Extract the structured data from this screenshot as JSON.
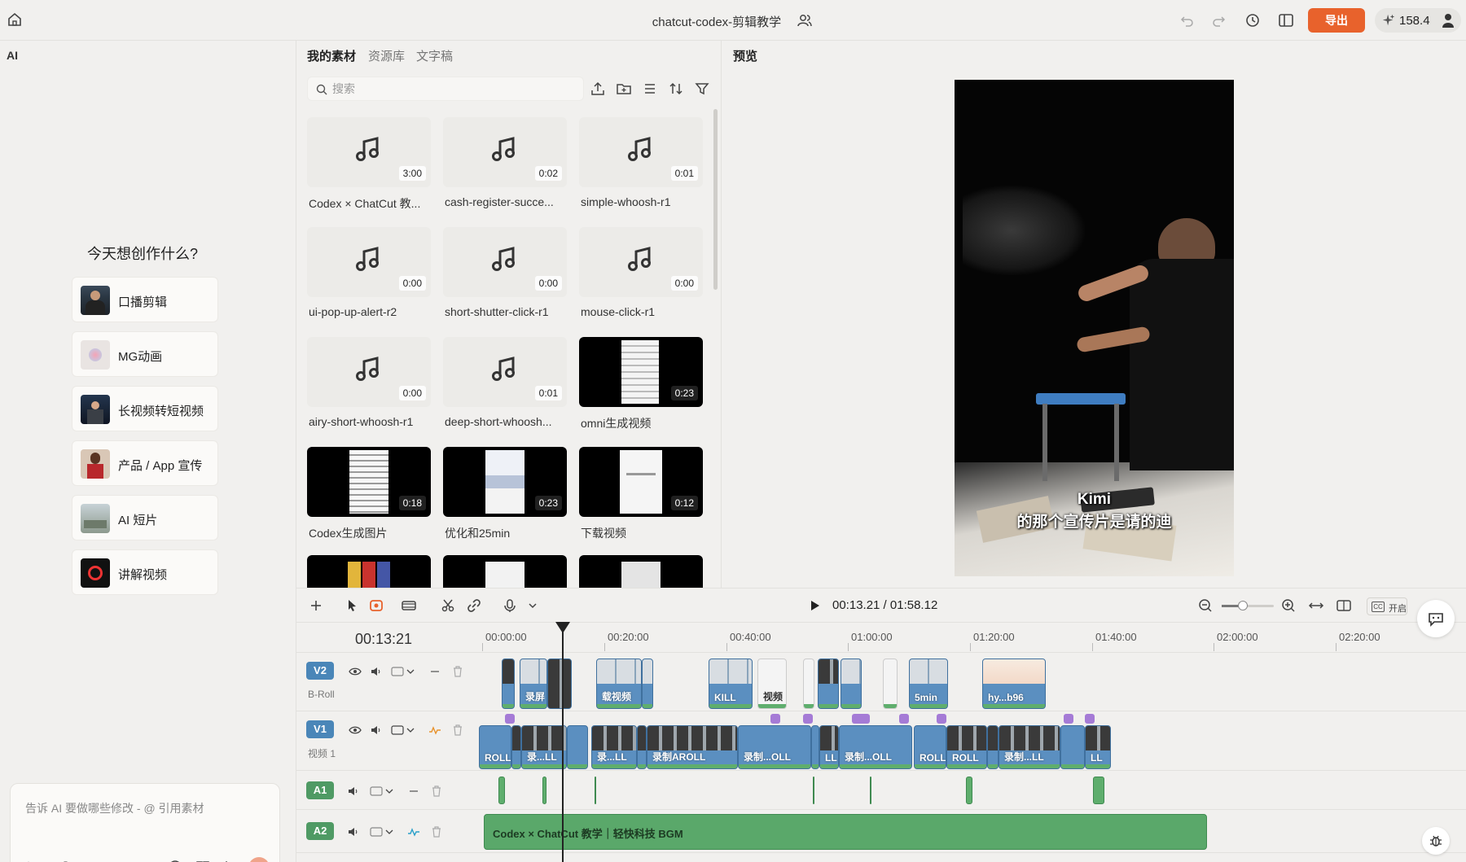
{
  "topbar": {
    "title": "chatcut-codex-剪辑教学",
    "export_label": "导出",
    "credits": "158.4"
  },
  "ai_panel": {
    "label": "AI",
    "heading": "今天想创作什么?",
    "templates": [
      {
        "label": "口播剪辑"
      },
      {
        "label": "MG动画"
      },
      {
        "label": "长视频转短视频"
      },
      {
        "label": "产品 / App 宣传"
      },
      {
        "label": "AI 短片"
      },
      {
        "label": "讲解视频"
      }
    ],
    "chat_placeholder": "告诉 AI 要做哪些修改 - @ 引用素材"
  },
  "media": {
    "tabs": [
      {
        "label": "我的素材",
        "active": true
      },
      {
        "label": "资源库",
        "active": false
      },
      {
        "label": "文字稿",
        "active": false
      }
    ],
    "search_placeholder": "搜索",
    "items": [
      {
        "name": "Codex × ChatCut 教...",
        "duration": "3:00",
        "kind": "audio"
      },
      {
        "name": "cash-register-succe...",
        "duration": "0:02",
        "kind": "audio"
      },
      {
        "name": "simple-whoosh-r1",
        "duration": "0:01",
        "kind": "audio"
      },
      {
        "name": "ui-pop-up-alert-r2",
        "duration": "0:00",
        "kind": "audio"
      },
      {
        "name": "short-shutter-click-r1",
        "duration": "0:00",
        "kind": "audio"
      },
      {
        "name": "mouse-click-r1",
        "duration": "0:00",
        "kind": "audio"
      },
      {
        "name": "airy-short-whoosh-r1",
        "duration": "0:00",
        "kind": "audio"
      },
      {
        "name": "deep-short-whoosh...",
        "duration": "0:01",
        "kind": "audio"
      },
      {
        "name": "omni生成视频",
        "duration": "0:23",
        "kind": "video"
      },
      {
        "name": "Codex生成图片",
        "duration": "0:18",
        "kind": "video"
      },
      {
        "name": "优化和25min",
        "duration": "0:23",
        "kind": "video"
      },
      {
        "name": "下载视频",
        "duration": "0:12",
        "kind": "video"
      }
    ]
  },
  "preview": {
    "label": "预览",
    "subtitle_line1": "Kimi",
    "subtitle_line2": "的那个宣传片是请的迪"
  },
  "timeline": {
    "timecode": "00:13.21 / 01:58.12",
    "current": "00:13:21",
    "cc_label": "开启",
    "ruler": [
      "00:00:00",
      "00:20:00",
      "00:40:00",
      "01:00:00",
      "01:20:00",
      "01:40:00",
      "02:00:00",
      "02:20:00"
    ],
    "tracks": {
      "v2": {
        "badge": "V2",
        "sub": "B-Roll"
      },
      "v1": {
        "badge": "V1",
        "sub": "视频 1"
      },
      "a1": {
        "badge": "A1"
      },
      "a2": {
        "badge": "A2"
      }
    },
    "v2_clips": [
      "录屏",
      "载视频",
      "KILL",
      "视频",
      "5min",
      "hy...b96"
    ],
    "v1_clips": [
      "ROLL",
      "录...LL",
      "录...LL",
      "录制AROLL",
      "录制...OLL",
      "LL",
      "录制...OLL",
      "ROLL",
      "ROLL",
      "录制...LL",
      "LL"
    ],
    "bgm_label": "Codex × ChatCut 教学｜轻快科技 BGM"
  },
  "colors": {
    "accent": "#e8622c",
    "video_track": "#5b8fc0",
    "audio_track": "#5fae6d"
  }
}
